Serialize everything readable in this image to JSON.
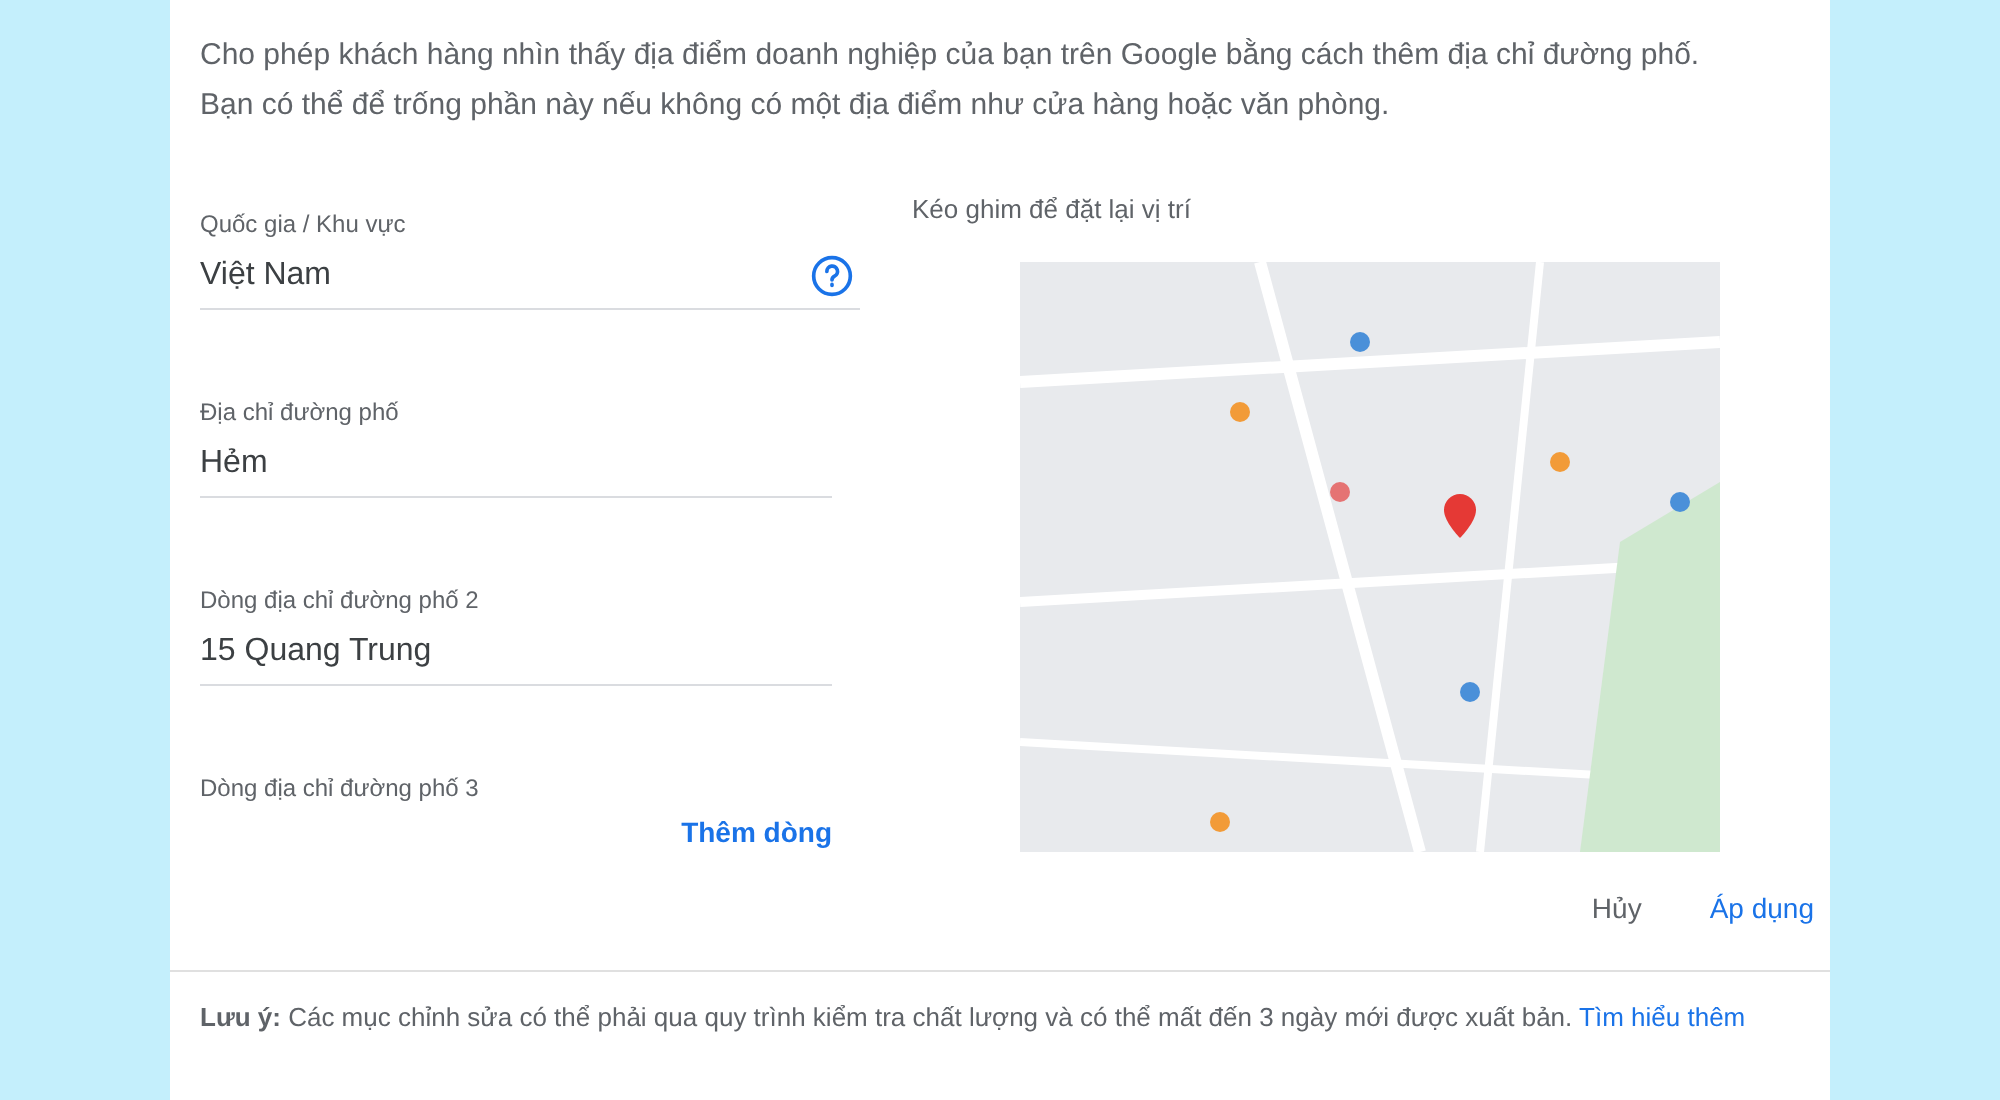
{
  "description": "Cho phép khách hàng nhìn thấy địa điểm doanh nghiệp của bạn trên Google bằng cách thêm địa chỉ đường phố.\nBạn có thể để trống phần này nếu không có một địa điểm như cửa hàng hoặc văn phòng.",
  "fields": [
    {
      "label": "Quốc gia / Khu vực",
      "value": "Việt Nam",
      "help": true
    },
    {
      "label": "Địa chỉ đường phố",
      "value": "Hẻm",
      "help": false
    },
    {
      "label": "Dòng địa chỉ đường phố 2",
      "value": "15 Quang Trung",
      "help": false
    }
  ],
  "last_field": {
    "label": "Dòng địa chỉ đường phố 3",
    "action": "Thêm dòng"
  },
  "map": {
    "hint": "Kéo ghim để đặt lại vị trí",
    "kind": "picture"
  },
  "buttons": {
    "cancel": "Hủy",
    "apply": "Áp dụng"
  },
  "note": {
    "text": "**Lưu ý:** Các mục chỉnh sửa có thể phải qua quy trình kiểm tra chất lượng và có thể mất đến 3 ngày mới được xuất bản.",
    "link": "Tìm hiểu thêm"
  }
}
